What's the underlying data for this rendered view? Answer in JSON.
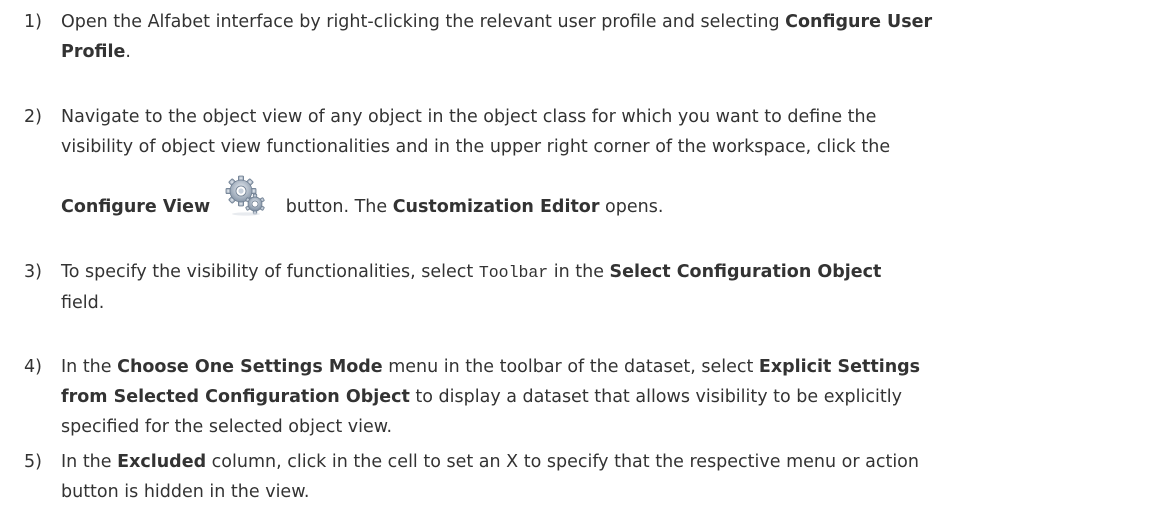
{
  "steps": [
    {
      "number": "1)",
      "line1_pre": "Open the Alfabet interface by right-clicking the relevant user profile and selecting ",
      "line1_bold": "Configure User",
      "line2_bold": "Profile",
      "line2_post": "."
    },
    {
      "number": "2)",
      "line1": "Navigate to the object view of any object in the object class for which you want to define the",
      "line2": "visibility of object view functionalities and in the upper right corner of the workspace, click the",
      "line3_bold1": "Configure View",
      "line3_mid": " button. The ",
      "line3_bold2": "Customization Editor",
      "line3_post": " opens.",
      "icon": "gear-icon"
    },
    {
      "number": "3)",
      "line1_pre": "To specify the visibility of functionalities, select ",
      "line1_code": "Toolbar",
      "line1_mid": " in the ",
      "line1_bold": "Select Configuration Object",
      "line2": "field."
    },
    {
      "number": "4)",
      "line1_pre": "In the ",
      "line1_bold1": "Choose One Settings Mode",
      "line1_mid": " menu in the toolbar of the dataset, select ",
      "line1_bold2": "Explicit Settings",
      "line2_bold": "from Selected Configuration Object",
      "line2_post": " to display a dataset that allows visibility to be explicitly",
      "line3": "specified for the selected object view."
    },
    {
      "number": "5)",
      "line1_pre": "In the ",
      "line1_bold": "Excluded",
      "line1_post": " column, click in the cell to set an X to specify that the respective menu or action",
      "line2": "button is hidden in the view."
    }
  ]
}
